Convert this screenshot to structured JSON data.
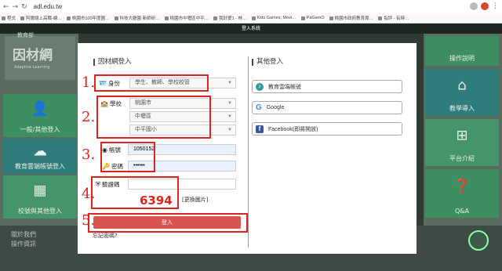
{
  "browser": {
    "url": "adl.edu.tw",
    "bookmarks": [
      "程式",
      "阿爾總上高職-線…",
      "桃園市100年度圖…",
      "科技大廳園 新師研…",
      "桃園市中壢區中平…",
      "我好愛1 - 林…",
      "Kids Games, Movi…",
      "PaGamO",
      "桃園市政府教育局…",
      "指評 - 有時…"
    ]
  },
  "site": {
    "header_title": "登入系統",
    "logo_small": "教育部",
    "logo_main": "因材網",
    "logo_en": "Adaptive Learning",
    "left_tiles": [
      "一般/其他登入",
      "教育雲端帳號登入",
      "校號與其他登入"
    ],
    "right_tiles": [
      "操作說明",
      "教學導入",
      "平台介紹",
      "Q&A"
    ],
    "footer_left": [
      "關於我們",
      "操作資訊"
    ]
  },
  "login": {
    "title": "因材網登入",
    "identity_label": "身份",
    "identity_value": "學生、教師、學校校管",
    "school_label": "學校",
    "city_value": "桃園市",
    "district_value": "中壢區",
    "school_value": "中平國小",
    "account_label": "帳號",
    "account_value": "1050152",
    "password_label": "密碼",
    "password_value": "••••••",
    "captcha_label": "驗證碼",
    "captcha_value": "6394",
    "refresh_label": "[更換圖片]",
    "login_button": "登入",
    "forgot_label": "忘記密碼?",
    "step_labels": [
      "1.",
      "2.",
      "3.",
      "4.",
      "5."
    ]
  },
  "other_login": {
    "title": "其他登入",
    "buttons": [
      "教育雲端帳號",
      "Google",
      "Facebook(即將開放)"
    ]
  }
}
